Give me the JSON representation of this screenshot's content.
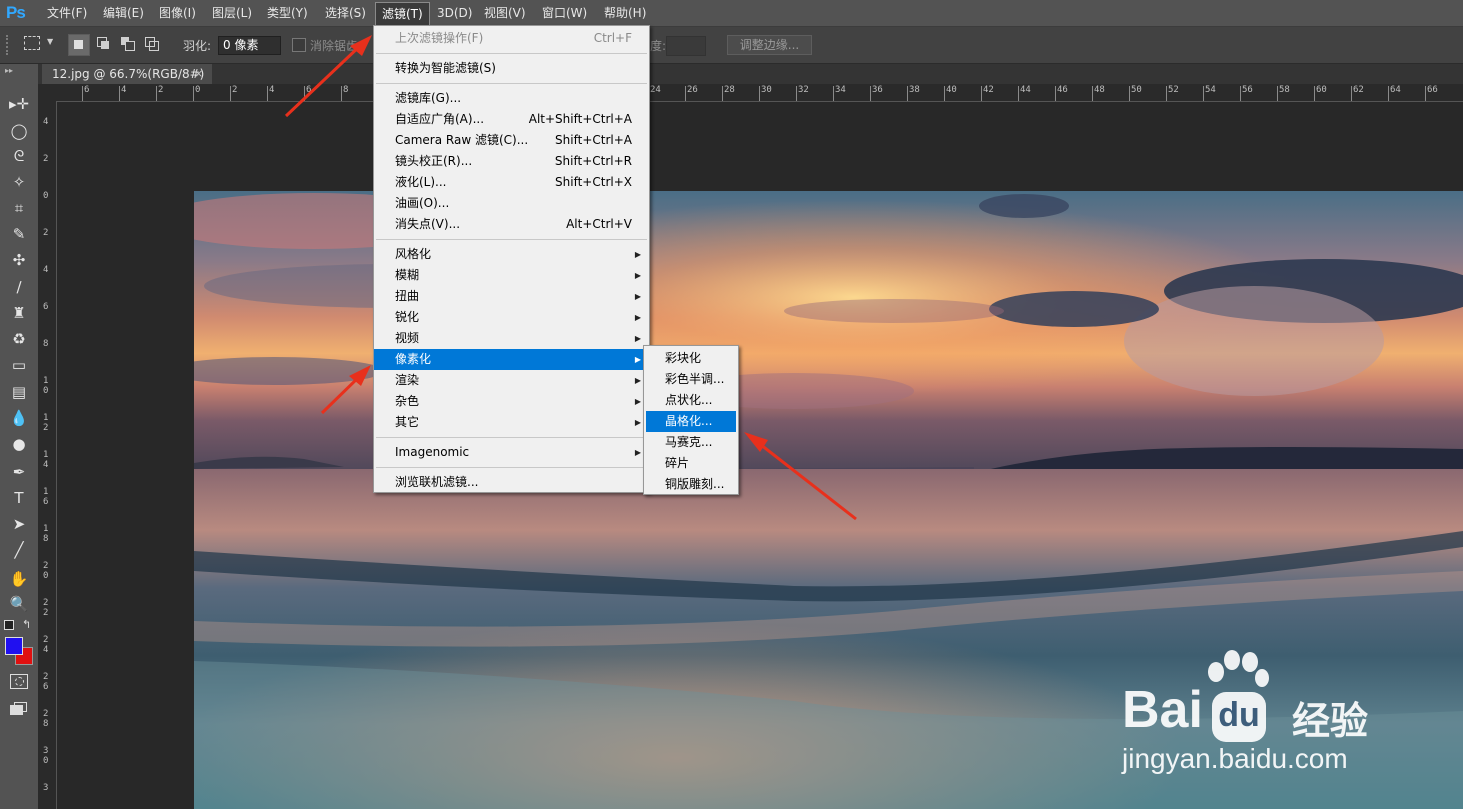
{
  "app": {
    "logo": "Ps"
  },
  "menubar": {
    "items": [
      "文件(F)",
      "编辑(E)",
      "图像(I)",
      "图层(L)",
      "类型(Y)",
      "选择(S)",
      "滤镜(T)",
      "3D(D)",
      "视图(V)",
      "窗口(W)",
      "帮助(H)"
    ],
    "active": "滤镜(T)"
  },
  "options": {
    "feather_label": "羽化:",
    "feather_value": "0 像素",
    "antialias_label": "消除锯齿",
    "refine_button": "调整边缘..."
  },
  "document": {
    "tab_title": "12.jpg @ 66.7%(RGB/8#)",
    "close": "×"
  },
  "rulers": {
    "top_ticks": [
      "6",
      "4",
      "2",
      "0",
      "2",
      "4",
      "6",
      "8",
      "24",
      "26",
      "28",
      "30",
      "32",
      "34",
      "36",
      "38",
      "40",
      "42",
      "44",
      "46",
      "48",
      "50",
      "52",
      "54",
      "56",
      "58",
      "60",
      "62",
      "64",
      "66"
    ],
    "left_ticks": [
      "4",
      "2",
      "0",
      "2",
      "4",
      "6",
      "8",
      "10",
      "12",
      "14",
      "16",
      "18",
      "20",
      "22",
      "24",
      "26",
      "28",
      "30",
      "3"
    ]
  },
  "filter_menu": {
    "items": [
      {
        "label": "上次滤镜操作(F)",
        "shortcut": "Ctrl+F",
        "disabled": true
      },
      {
        "sep": true
      },
      {
        "label": "转换为智能滤镜(S)",
        "shortcut": ""
      },
      {
        "sep": true
      },
      {
        "label": "滤镜库(G)...",
        "shortcut": ""
      },
      {
        "label": "自适应广角(A)...",
        "shortcut": "Alt+Shift+Ctrl+A"
      },
      {
        "label": "Camera Raw 滤镜(C)...",
        "shortcut": "Shift+Ctrl+A"
      },
      {
        "label": "镜头校正(R)...",
        "shortcut": "Shift+Ctrl+R"
      },
      {
        "label": "液化(L)...",
        "shortcut": "Shift+Ctrl+X"
      },
      {
        "label": "油画(O)...",
        "shortcut": ""
      },
      {
        "label": "消失点(V)...",
        "shortcut": "Alt+Ctrl+V"
      },
      {
        "sep": true
      },
      {
        "label": "风格化",
        "submenu": true
      },
      {
        "label": "模糊",
        "submenu": true
      },
      {
        "label": "扭曲",
        "submenu": true
      },
      {
        "label": "锐化",
        "submenu": true
      },
      {
        "label": "视频",
        "submenu": true
      },
      {
        "label": "像素化",
        "submenu": true,
        "highlighted": true
      },
      {
        "label": "渲染",
        "submenu": true
      },
      {
        "label": "杂色",
        "submenu": true
      },
      {
        "label": "其它",
        "submenu": true
      },
      {
        "sep": true
      },
      {
        "label": "Imagenomic",
        "submenu": true
      },
      {
        "sep": true
      },
      {
        "label": "浏览联机滤镜...",
        "shortcut": ""
      }
    ]
  },
  "pixelate_submenu": {
    "items": [
      "彩块化",
      "彩色半调...",
      "点状化...",
      "晶格化...",
      "马赛克...",
      "碎片",
      "铜版雕刻..."
    ],
    "highlighted": "晶格化..."
  },
  "colors": {
    "foreground": "#2010f0",
    "background": "#e01010",
    "highlight": "#0078d7",
    "arrow": "#e8301c"
  },
  "watermark": {
    "brand": "Bai",
    "brand_du": "du",
    "cn": "经验",
    "url": "jingyan.baidu.com"
  },
  "icons": {
    "tools": [
      "move-icon",
      "ellipse-marquee-icon",
      "lasso-icon",
      "magic-wand-icon",
      "crop-icon",
      "eyedropper-icon",
      "healing-brush-icon",
      "brush-icon",
      "stamp-icon",
      "history-brush-icon",
      "eraser-icon",
      "gradient-icon",
      "blur-icon",
      "dodge-icon",
      "pen-icon",
      "type-icon",
      "path-select-icon",
      "line-icon",
      "hand-icon",
      "zoom-icon"
    ]
  }
}
